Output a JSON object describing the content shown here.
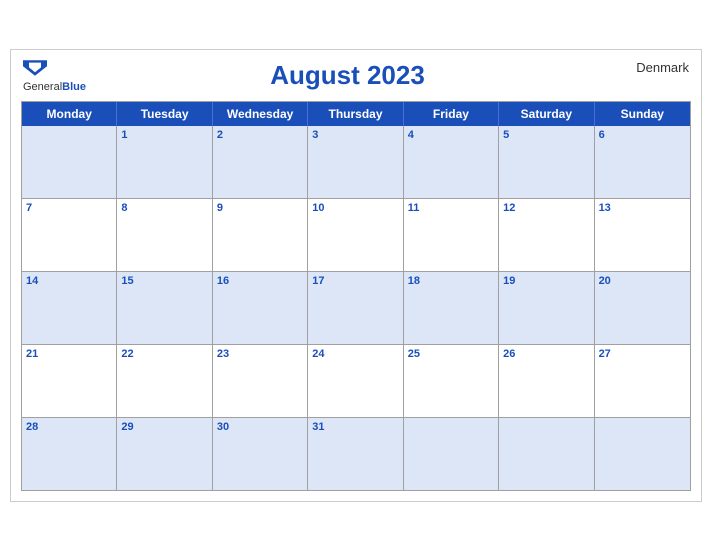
{
  "header": {
    "logo_general": "General",
    "logo_blue": "Blue",
    "title": "August 2023",
    "country": "Denmark"
  },
  "day_headers": [
    "Monday",
    "Tuesday",
    "Wednesday",
    "Thursday",
    "Friday",
    "Saturday",
    "Sunday"
  ],
  "weeks": [
    [
      "",
      "1",
      "2",
      "3",
      "4",
      "5",
      "6"
    ],
    [
      "7",
      "8",
      "9",
      "10",
      "11",
      "12",
      "13"
    ],
    [
      "14",
      "15",
      "16",
      "17",
      "18",
      "19",
      "20"
    ],
    [
      "21",
      "22",
      "23",
      "24",
      "25",
      "26",
      "27"
    ],
    [
      "28",
      "29",
      "30",
      "31",
      "",
      "",
      ""
    ]
  ]
}
